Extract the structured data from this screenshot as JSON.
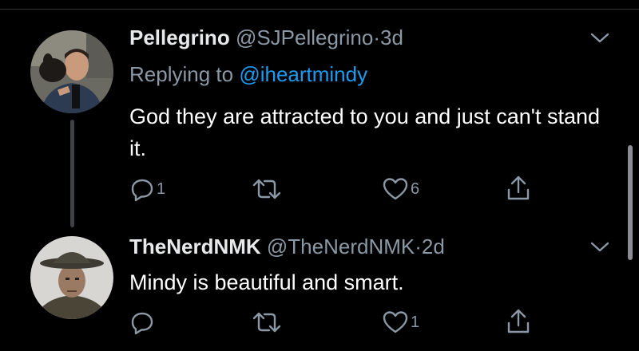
{
  "tweets": [
    {
      "name": "Pellegrino",
      "handle": "@SJPellegrino",
      "separator": "·",
      "time": "3d",
      "replying_prefix": "Replying to",
      "replying_to": "@iheartmindy",
      "text": "God they are attracted to you and just can't stand it.",
      "reply_count": "1",
      "retweet_count": "",
      "like_count": "6"
    },
    {
      "name": "TheNerdNMK",
      "handle": "@TheNerdNMK",
      "separator": "·",
      "time": "2d",
      "text": "Mindy is beautiful and smart.",
      "reply_count": "",
      "retweet_count": "",
      "like_count": "1"
    }
  ],
  "icons": {
    "reply": "reply-icon",
    "retweet": "retweet-icon",
    "like": "heart-icon",
    "share": "share-icon",
    "more": "chevron-down-icon"
  },
  "colors": {
    "background": "#000000",
    "name": "#e7e9ea",
    "secondary": "#8b98a5",
    "mention": "#1d9bf0"
  }
}
